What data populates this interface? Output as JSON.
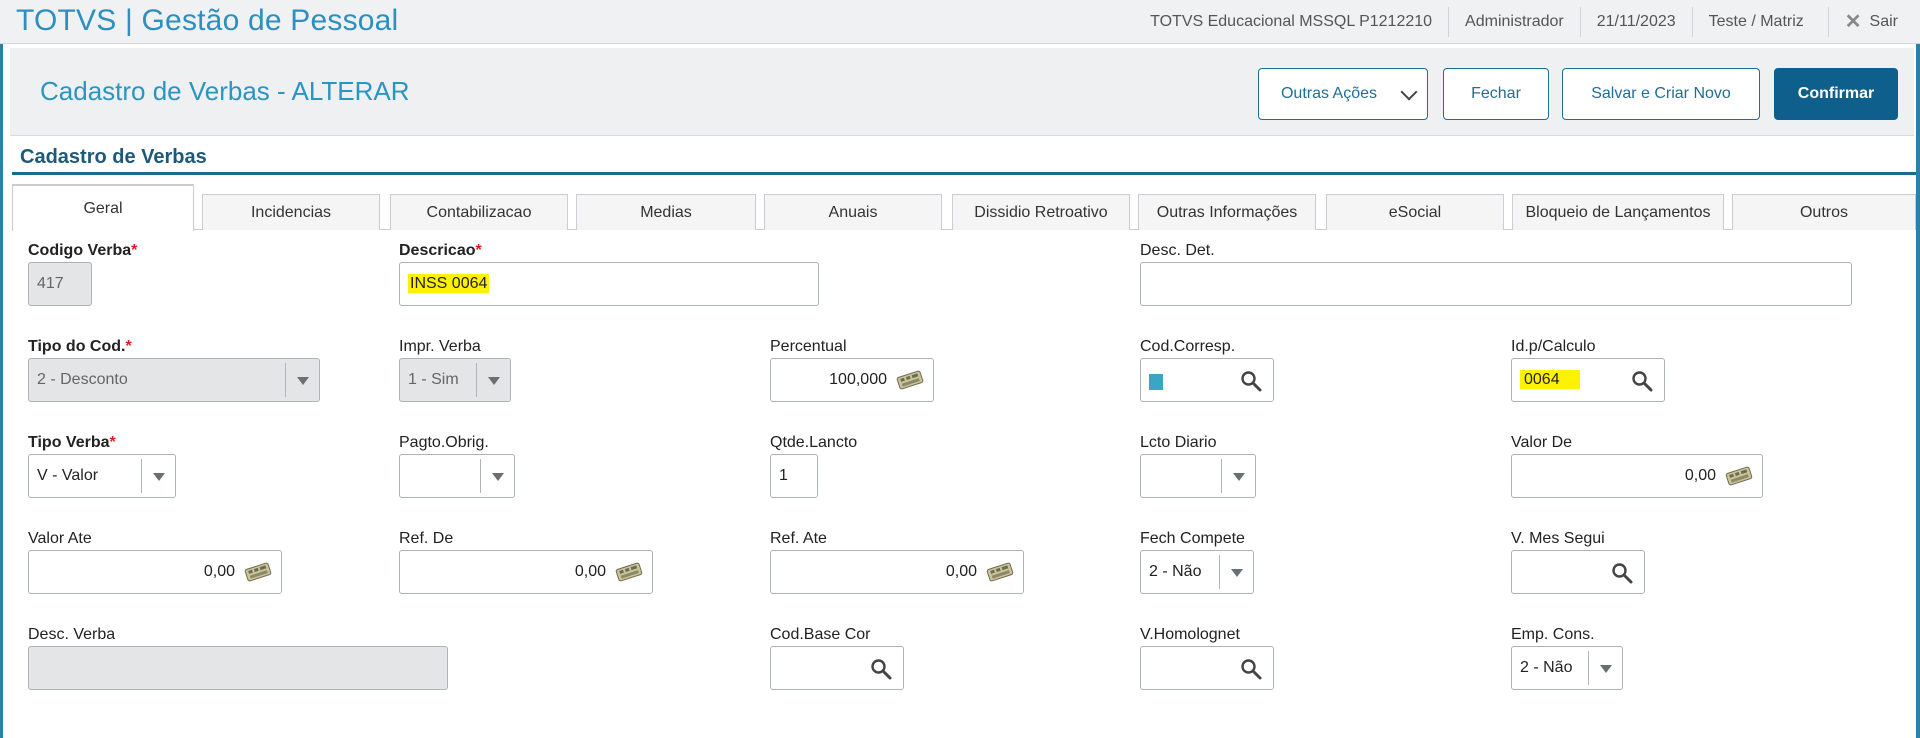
{
  "app": {
    "title": "TOTVS | Gestão de Pessoal",
    "environment": "TOTVS Educacional MSSQL P1212210",
    "user": "Administrador",
    "date": "21/11/2023",
    "branch": "Teste / Matriz",
    "exit_label": "Sair"
  },
  "page": {
    "title": "Cadastro de Verbas - ALTERAR",
    "section_title": "Cadastro de Verbas"
  },
  "actions": {
    "other_actions": "Outras Ações",
    "close": "Fechar",
    "save_new": "Salvar e Criar Novo",
    "confirm": "Confirmar"
  },
  "tabs": [
    "Geral",
    "Incidencias",
    "Contabilizacao",
    "Medias",
    "Anuais",
    "Dissidio Retroativo",
    "Outras Informações",
    "eSocial",
    "Bloqueio de Lançamentos",
    "Outros"
  ],
  "fields": {
    "codigo_verba": {
      "label": "Codigo Verba",
      "required": "*",
      "value": "417"
    },
    "descricao": {
      "label": "Descricao",
      "required": "*",
      "value": "INSS 0064"
    },
    "desc_det": {
      "label": "Desc. Det.",
      "value": ""
    },
    "tipo_cod": {
      "label": "Tipo do Cod.",
      "required": "*",
      "value": "2 - Desconto"
    },
    "impr_verba": {
      "label": "Impr. Verba",
      "value": "1 - Sim"
    },
    "percentual": {
      "label": "Percentual",
      "value": "100,000"
    },
    "cod_corresp": {
      "label": "Cod.Corresp.",
      "value": ""
    },
    "id_calculo": {
      "label": "Id.p/Calculo",
      "value": "0064"
    },
    "tipo_verba": {
      "label": "Tipo Verba",
      "required": "*",
      "value": "V - Valor"
    },
    "pagto_obrig": {
      "label": "Pagto.Obrig.",
      "value": ""
    },
    "qtde_lancto": {
      "label": "Qtde.Lancto",
      "value": "1"
    },
    "lcto_diario": {
      "label": "Lcto Diario",
      "value": ""
    },
    "valor_de": {
      "label": "Valor De",
      "value": "0,00"
    },
    "valor_ate": {
      "label": "Valor Ate",
      "value": "0,00"
    },
    "ref_de": {
      "label": "Ref. De",
      "value": "0,00"
    },
    "ref_ate": {
      "label": "Ref. Ate",
      "value": "0,00"
    },
    "fech_compete": {
      "label": "Fech Compete",
      "value": "2 - Não"
    },
    "v_mes_segui": {
      "label": "V. Mes Segui",
      "value": ""
    },
    "desc_verba": {
      "label": "Desc. Verba",
      "value": ""
    },
    "cod_base_cor": {
      "label": "Cod.Base Cor",
      "value": ""
    },
    "v_homolognet": {
      "label": "V.Homolognet",
      "value": ""
    },
    "emp_cons": {
      "label": "Emp. Cons.",
      "value": "2 - Não"
    }
  },
  "colors": {
    "brand": "#2c8fbf",
    "primary_button": "#0f5f8c",
    "highlight": "#fff200",
    "required_star": "#e21b1b"
  }
}
